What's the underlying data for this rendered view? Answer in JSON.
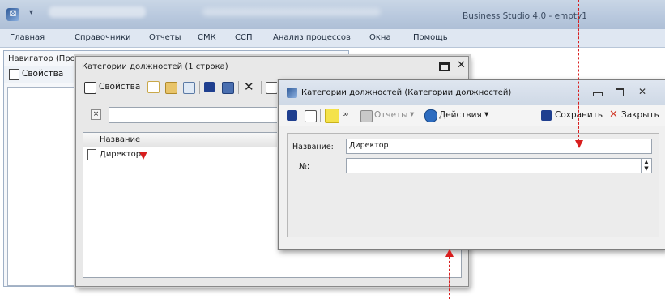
{
  "app": {
    "title": "Business Studio 4.0 - empty1",
    "logo_glyph": "⚄"
  },
  "menu": {
    "items": [
      "Главная",
      "Справочники",
      "Отчеты",
      "СМК",
      "ССП",
      "Анализ процессов",
      "Окна",
      "Помощь"
    ]
  },
  "navigator": {
    "title": "Навигатор (Про",
    "properties_label": "Свойства"
  },
  "list_window": {
    "title": "Категории должностей (1 строка)",
    "properties_label": "Свойства",
    "filter_clear": "×",
    "grid": {
      "columns": [
        "Название"
      ],
      "rows": [
        {
          "name": "Директор"
        }
      ]
    }
  },
  "edit_window": {
    "title": "Категории должностей (Категории должностей)",
    "toolbar": {
      "reports_label": "Отчеты",
      "actions_label": "Действия",
      "save_label": "Сохранить",
      "close_label": "Закрыть"
    },
    "form": {
      "name_label": "Название:",
      "name_value": "Директор",
      "number_label": "№:",
      "number_value": ""
    }
  },
  "icons": {
    "close": "✕",
    "chevron": "▾",
    "spin_up": "▲",
    "spin_down": "▼"
  },
  "colors": {
    "annotation": "#d81e1e",
    "save_icon": "#1f3f8f",
    "close_x": "#d13b2a"
  }
}
